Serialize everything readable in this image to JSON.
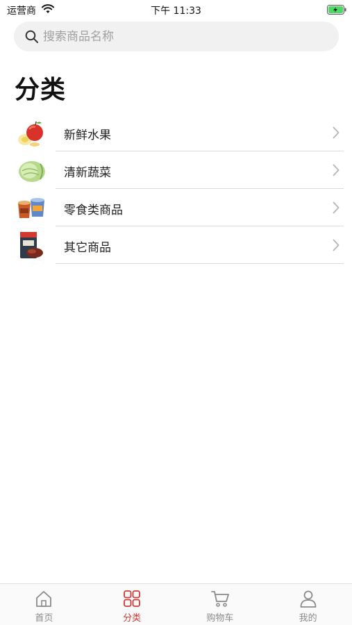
{
  "status_bar": {
    "carrier": "运营商",
    "time": "下午 11:33"
  },
  "search": {
    "placeholder": "搜索商品名称",
    "value": ""
  },
  "page": {
    "title": "分类"
  },
  "categories": [
    {
      "label": "新鲜水果",
      "icon": "apple-thumbnail"
    },
    {
      "label": "清新蔬菜",
      "icon": "cabbage-thumbnail"
    },
    {
      "label": "零食类商品",
      "icon": "snack-cup-thumbnail"
    },
    {
      "label": "其它商品",
      "icon": "package-thumbnail"
    }
  ],
  "tab_bar": {
    "tabs": [
      {
        "label": "首页",
        "icon": "home-icon",
        "active": false
      },
      {
        "label": "分类",
        "icon": "grid-icon",
        "active": true
      },
      {
        "label": "购物车",
        "icon": "cart-icon",
        "active": false
      },
      {
        "label": "我的",
        "icon": "person-icon",
        "active": false
      }
    ]
  },
  "colors": {
    "accent": "#d03a35",
    "inactive": "#8a8a8a",
    "search_bg": "#f1f1f1",
    "battery_green": "#4cd964"
  }
}
